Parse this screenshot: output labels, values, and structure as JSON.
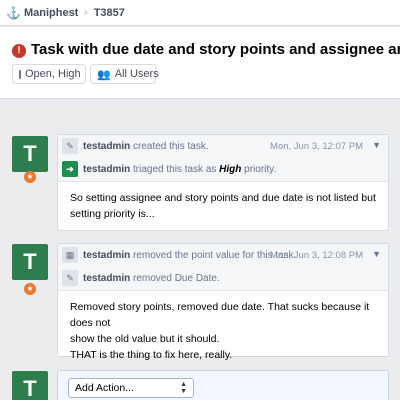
{
  "breadcrumb": {
    "app": "Maniphest",
    "task_id": "T3857"
  },
  "header": {
    "title": "Task with due date and story points and assignee and priorit",
    "status_pill": "Open, High",
    "policy_pill": "All Users"
  },
  "transactions": [
    {
      "avatar_letter": "T",
      "events": [
        {
          "icon": "pencil-icon",
          "author": "testadmin",
          "action": "created this task.",
          "time": "Mon, Jun 3, 12:07 PM"
        },
        {
          "icon": "arrow-right-icon",
          "author": "testadmin",
          "action": "triaged this task as",
          "value": "High",
          "suffix": "priority."
        }
      ],
      "comment": "So setting assignee and story points and due date is not listed but setting priority is..."
    },
    {
      "avatar_letter": "T",
      "events": [
        {
          "icon": "calculator-icon",
          "author": "testadmin",
          "action": "removed the point value for this task.",
          "time": "Mon, Jun 3, 12:08 PM"
        },
        {
          "icon": "pencil-icon",
          "author": "testadmin",
          "action": "removed Due Date."
        }
      ],
      "comment_lines": [
        "Removed story points, removed due date. That sucks because it does not",
        "show the old value but it should.",
        "THAT is the thing to fix here, really."
      ]
    }
  ],
  "composer": {
    "avatar_letter": "T",
    "action_select": "Add Action..."
  },
  "colors": {
    "avatar": "#2e7d4f",
    "badge": "#e8782e",
    "error": "#c0392b",
    "triage": "#1e8e4e"
  }
}
